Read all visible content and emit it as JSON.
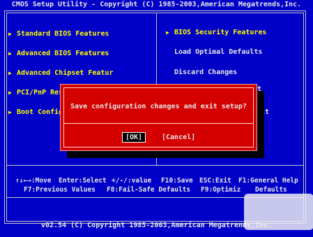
{
  "title": "CMOS Setup Utility - Copyright (C) 1985-2003,American Megatrends,Inc.",
  "left_menu": [
    {
      "label": "Standard BIOS Features",
      "arrow": true
    },
    {
      "label": "Advanced BIOS Features",
      "arrow": true
    },
    {
      "label": "Advanced Chipset Featur",
      "arrow": true
    },
    {
      "label": "PCI/PnP Res",
      "arrow": true
    },
    {
      "label": "Boot Config",
      "arrow": true
    }
  ],
  "right_menu": [
    {
      "label": "BIOS Security Features",
      "arrow": true
    },
    {
      "label": "Load Optimal Defaults",
      "arrow": false
    },
    {
      "label": "Discard Changes",
      "arrow": false
    },
    {
      "label": "t",
      "arrow": false
    },
    {
      "label": "xit",
      "arrow": false
    }
  ],
  "arrow_glyph": "▶",
  "help": {
    "line1_a": "↑↓←→:Move",
    "line1_b": "Enter:Select",
    "line1_c": "+/-/:value",
    "line1_d": "F10:Save",
    "line1_e": "ESC:Exit",
    "line1_f": "F1:General Help",
    "line2_a": "F7:Previous Values",
    "line2_b": "F8:Fail-Safe Defaults",
    "line2_c": "F9:Optimiz",
    "line2_d": "Defaults"
  },
  "footer": "v02.54 (C) Copyright 1985-2003,American Megatrends,Inc.",
  "dialog": {
    "message": "Save configuration changes and exit setup?",
    "ok_label": "[OK]",
    "cancel_label": "[Cancel]"
  },
  "colors": {
    "background": "#0000c8",
    "dialog": "#d40000",
    "highlight": "#ffff00",
    "text": "#e8e8e8"
  }
}
